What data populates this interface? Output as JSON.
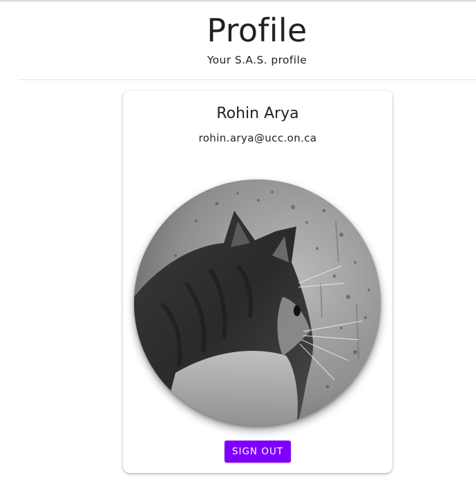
{
  "header": {
    "title": "Profile",
    "subtitle": "Your S.A.S. profile"
  },
  "profile": {
    "name": "Rohin Arya",
    "email": "rohin.arya@ucc.on.ca",
    "avatar_icon": "cat-photo"
  },
  "actions": {
    "sign_out_label": "Sign out"
  },
  "colors": {
    "accent": "#7f00ff",
    "text": "#212121",
    "divider": "#e2e2e2"
  }
}
